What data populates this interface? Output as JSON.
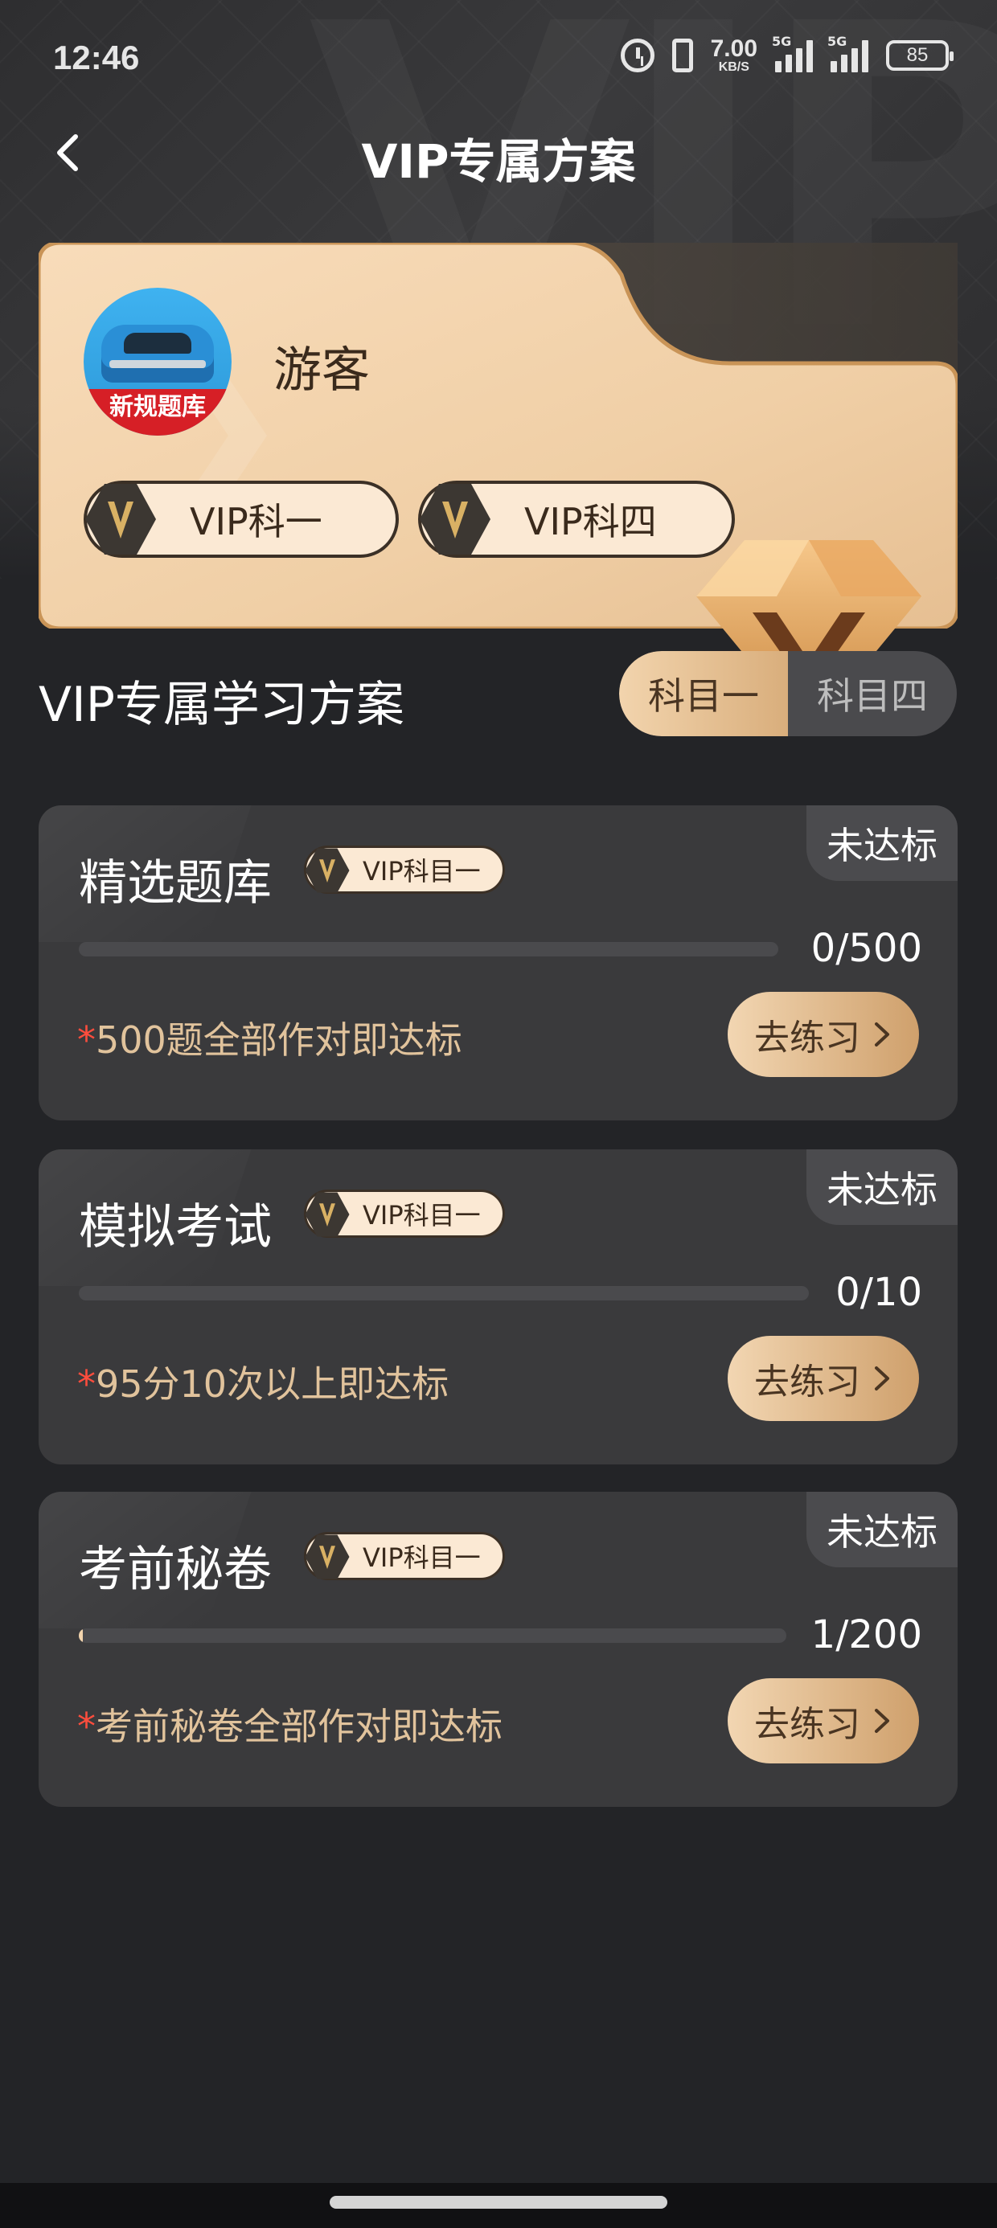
{
  "status_bar": {
    "time": "12:46",
    "net_speed_value": "7.00",
    "net_speed_unit": "KB/S",
    "signal_1_tag": "5G",
    "signal_2_tag": "5G",
    "battery": "85"
  },
  "nav": {
    "title": "VIP专属方案",
    "back_icon": "chevron-left-icon"
  },
  "member": {
    "avatar_banner": "新规题库",
    "name": "游客",
    "badges": [
      {
        "label": "VIP科一",
        "icon": "vip-v-icon"
      },
      {
        "label": "VIP科四",
        "icon": "vip-v-icon"
      }
    ]
  },
  "plan": {
    "title": "VIP专属学习方案",
    "subjects": [
      {
        "label": "科目一",
        "active": true
      },
      {
        "label": "科目四",
        "active": false
      }
    ]
  },
  "tasks": [
    {
      "title": "精选题库",
      "vip_tag": "VIP科目一",
      "status": "未达标",
      "count": "0/500",
      "progress": 0,
      "requirement": "500题全部作对即达标",
      "button": "去练习"
    },
    {
      "title": "模拟考试",
      "vip_tag": "VIP科目一",
      "status": "未达标",
      "count": "0/10",
      "progress": 0,
      "requirement": "95分10次以上即达标",
      "button": "去练习"
    },
    {
      "title": "考前秘卷",
      "vip_tag": "VIP科目一",
      "status": "未达标",
      "count": "1/200",
      "progress": 0.005,
      "requirement": "考前秘卷全部作对即达标",
      "button": "去练习"
    }
  ],
  "colors": {
    "background": "#232427",
    "card": "#3a3a3c",
    "gold_light": "#f2d4ad",
    "gold_dark": "#cfa06c",
    "requirement_text": "#e1c39c",
    "required_star": "#ff4d3d"
  }
}
